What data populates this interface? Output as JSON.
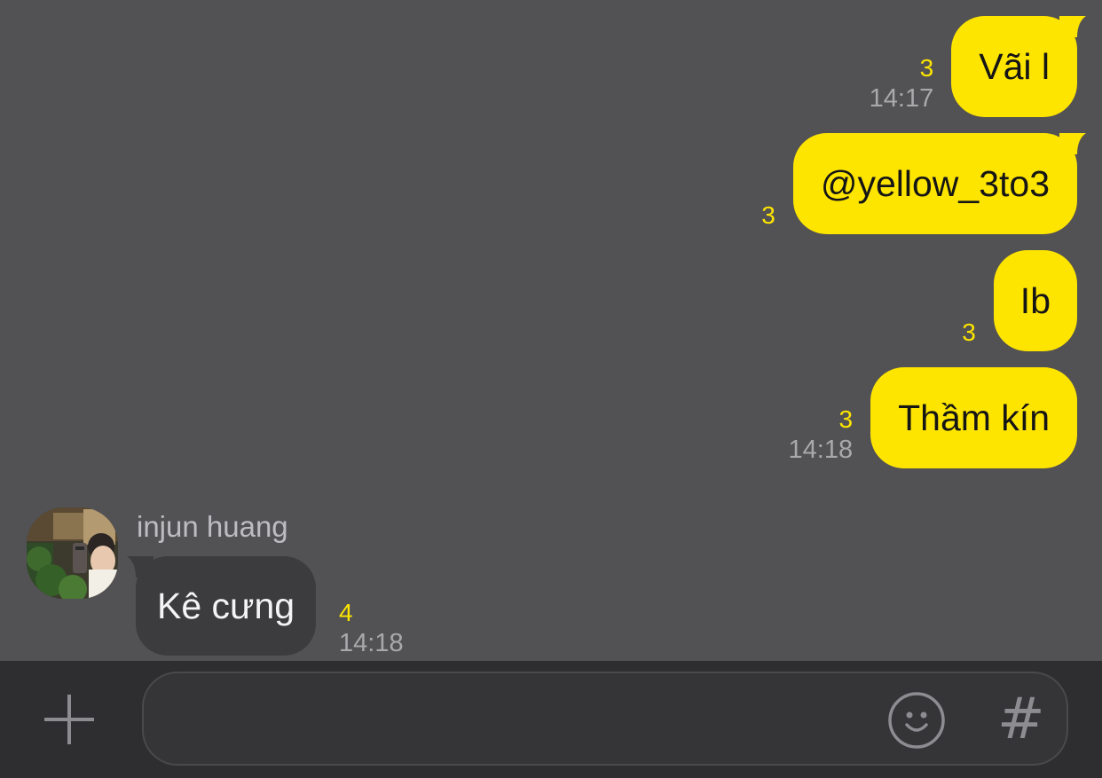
{
  "messages_outgoing": [
    {
      "text": "Vãi l",
      "unread": "3",
      "time": "14:17"
    },
    {
      "text": "@yellow_3to3",
      "unread": "3",
      "time": ""
    },
    {
      "text": "Ib",
      "unread": "3",
      "time": ""
    },
    {
      "text": "Thầm kín",
      "unread": "3",
      "time": "14:18"
    }
  ],
  "message_incoming": {
    "sender": "injun huang",
    "text": "Kê cưng",
    "unread": "4",
    "time": "14:18"
  },
  "composer": {
    "value": "",
    "placeholder": "",
    "plus_icon": "plus-icon",
    "emoji_icon": "smiley-icon",
    "hashtag_label": "#"
  },
  "colors": {
    "background": "#525153",
    "outgoing_bubble": "#fee500",
    "incoming_bubble": "#3c3b3e",
    "unread_count": "#fce400",
    "composer_bar": "#2e2d2f"
  }
}
